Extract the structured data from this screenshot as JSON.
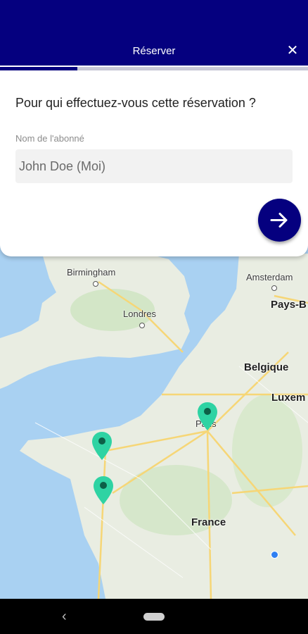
{
  "header": {
    "title": "Réserver",
    "close_icon": "close-icon"
  },
  "progress": {
    "fraction": 0.25
  },
  "form": {
    "question": "Pour qui effectuez-vous cette réservation ?",
    "subscriber_label": "Nom de l'abonné",
    "subscriber_value": "John Doe (Moi)",
    "next_icon": "arrow-right-icon"
  },
  "map": {
    "labels": {
      "birmingham": "Birmingham",
      "londres": "Londres",
      "amsterdam": "Amsterdam",
      "pays_bas": "Pays-B",
      "belgique": "Belgique",
      "luxem": "Luxem",
      "paris": "Paris",
      "france": "France"
    },
    "pin_color": "#2ed3a3",
    "water_color": "#a9d1f2",
    "land_color": "#e9ede2"
  },
  "navbar": {
    "back_icon": "back-icon",
    "home_icon": "home-pill-icon"
  },
  "colors": {
    "primary": "#05007f"
  }
}
